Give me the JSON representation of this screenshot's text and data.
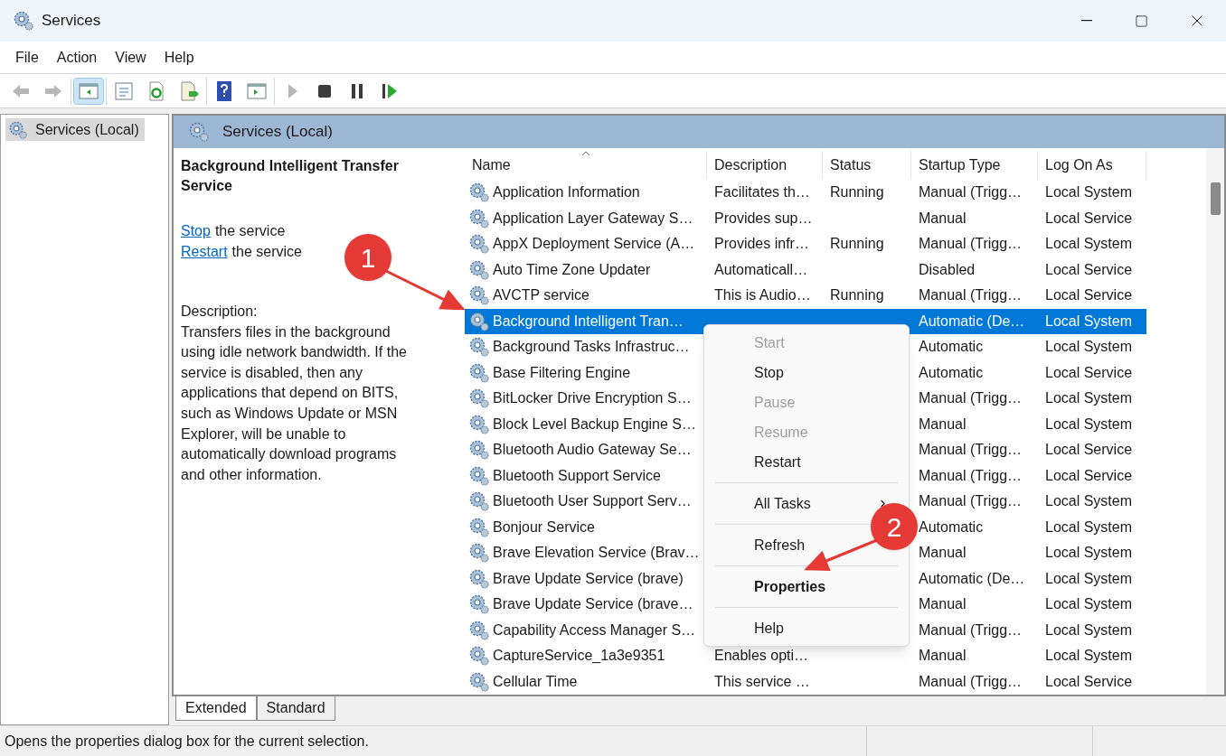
{
  "window": {
    "title": "Services"
  },
  "menu": [
    "File",
    "Action",
    "View",
    "Help"
  ],
  "toolbar": [
    {
      "kind": "back",
      "disabled": true,
      "pressed": false
    },
    {
      "kind": "forward",
      "disabled": true,
      "pressed": false
    },
    {
      "kind": "console-tree",
      "disabled": false,
      "pressed": true
    },
    {
      "kind": "properties",
      "disabled": false,
      "pressed": false
    },
    {
      "kind": "refresh",
      "disabled": false,
      "pressed": false
    },
    {
      "kind": "export",
      "disabled": false,
      "pressed": false
    },
    {
      "kind": "help",
      "disabled": false,
      "pressed": false
    },
    {
      "kind": "action-pane",
      "disabled": false,
      "pressed": false
    },
    {
      "kind": "play",
      "disabled": true,
      "pressed": false
    },
    {
      "kind": "stop",
      "disabled": false,
      "pressed": false
    },
    {
      "kind": "pause",
      "disabled": false,
      "pressed": false
    },
    {
      "kind": "resume",
      "disabled": false,
      "pressed": false
    }
  ],
  "tree": [
    {
      "label": "Services (Local)",
      "selected": true
    }
  ],
  "panel_header": "Services (Local)",
  "details": {
    "title": "Background Intelligent Transfer Service",
    "actions": [
      {
        "link": "Stop",
        "text": "the service"
      },
      {
        "link": "Restart",
        "text": "the service"
      }
    ],
    "description_label": "Description:",
    "description": "Transfers files in the background using idle network bandwidth. If the service is disabled, then any applications that depend on BITS, such as Windows Update or MSN Explorer, will be unable to automatically download programs and other information."
  },
  "table": {
    "columns": [
      {
        "label": "Name",
        "sorted": true
      },
      {
        "label": "Description",
        "sorted": false
      },
      {
        "label": "Status",
        "sorted": false
      },
      {
        "label": "Startup Type",
        "sorted": false
      },
      {
        "label": "Log On As",
        "sorted": false
      }
    ],
    "rows": [
      {
        "name": "Application Information",
        "description": "Facilitates th…",
        "status": "Running",
        "startup_type": "Manual (Trigg…",
        "log_on_as": "Local System",
        "selected": false
      },
      {
        "name": "Application Layer Gateway S…",
        "description": "Provides sup…",
        "startup_type": "Manual",
        "log_on_as": "Local Service",
        "selected": false
      },
      {
        "name": "AppX Deployment Service (A…",
        "description": "Provides infr…",
        "status": "Running",
        "startup_type": "Manual (Trigg…",
        "log_on_as": "Local System",
        "selected": false
      },
      {
        "name": "Auto Time Zone Updater",
        "description": "Automaticall…",
        "startup_type": "Disabled",
        "log_on_as": "Local Service",
        "selected": false
      },
      {
        "name": "AVCTP service",
        "description": "This is Audio…",
        "status": "Running",
        "startup_type": "Manual (Trigg…",
        "log_on_as": "Local Service",
        "selected": false
      },
      {
        "name": "Background Intelligent Tran…",
        "startup_type": "Automatic (De…",
        "log_on_as": "Local System",
        "selected": true
      },
      {
        "name": "Background Tasks Infrastruc…",
        "startup_type": "Automatic",
        "log_on_as": "Local System",
        "selected": false
      },
      {
        "name": "Base Filtering Engine",
        "startup_type": "Automatic",
        "log_on_as": "Local Service",
        "selected": false
      },
      {
        "name": "BitLocker Drive Encryption S…",
        "startup_type": "Manual (Trigg…",
        "log_on_as": "Local System",
        "selected": false
      },
      {
        "name": "Block Level Backup Engine S…",
        "startup_type": "Manual",
        "log_on_as": "Local System",
        "selected": false
      },
      {
        "name": "Bluetooth Audio Gateway Se…",
        "startup_type": "Manual (Trigg…",
        "log_on_as": "Local Service",
        "selected": false
      },
      {
        "name": "Bluetooth Support Service",
        "startup_type": "Manual (Trigg…",
        "log_on_as": "Local Service",
        "selected": false
      },
      {
        "name": "Bluetooth User Support Serv…",
        "startup_type": "Manual (Trigg…",
        "log_on_as": "Local System",
        "selected": false
      },
      {
        "name": "Bonjour Service",
        "startup_type": "Automatic",
        "log_on_as": "Local System",
        "selected": false
      },
      {
        "name": "Brave Elevation Service (Brav…",
        "startup_type": "Manual",
        "log_on_as": "Local System",
        "selected": false
      },
      {
        "name": "Brave Update Service (brave)",
        "startup_type": "Automatic (De…",
        "log_on_as": "Local System",
        "selected": false
      },
      {
        "name": "Brave Update Service (brave…",
        "startup_type": "Manual",
        "log_on_as": "Local System",
        "selected": false
      },
      {
        "name": "Capability Access Manager S…",
        "startup_type": "Manual (Trigg…",
        "log_on_as": "Local System",
        "selected": false
      },
      {
        "name": "CaptureService_1a3e9351",
        "description": "Enables opti…",
        "startup_type": "Manual",
        "log_on_as": "Local System",
        "selected": false
      },
      {
        "name": "Cellular Time",
        "description": "This service …",
        "startup_type": "Manual (Trigg…",
        "log_on_as": "Local Service",
        "selected": false
      }
    ]
  },
  "context_menu": [
    {
      "kind": "item",
      "label": "Start",
      "disabled": true,
      "bold": false,
      "submenu": false
    },
    {
      "kind": "item",
      "label": "Stop",
      "disabled": false,
      "bold": false,
      "submenu": false
    },
    {
      "kind": "item",
      "label": "Pause",
      "disabled": true,
      "bold": false,
      "submenu": false
    },
    {
      "kind": "item",
      "label": "Resume",
      "disabled": true,
      "bold": false,
      "submenu": false
    },
    {
      "kind": "item",
      "label": "Restart",
      "disabled": false,
      "bold": false,
      "submenu": false
    },
    {
      "kind": "separator"
    },
    {
      "kind": "item",
      "label": "All Tasks",
      "disabled": false,
      "bold": false,
      "submenu": true
    },
    {
      "kind": "separator"
    },
    {
      "kind": "item",
      "label": "Refresh",
      "disabled": false,
      "bold": false,
      "submenu": false
    },
    {
      "kind": "separator"
    },
    {
      "kind": "item",
      "label": "Properties",
      "disabled": false,
      "bold": true,
      "submenu": false
    },
    {
      "kind": "separator"
    },
    {
      "kind": "item",
      "label": "Help",
      "disabled": false,
      "bold": false,
      "submenu": false
    }
  ],
  "tabs": [
    {
      "label": "Extended",
      "selected": true
    },
    {
      "label": "Standard",
      "selected": false
    }
  ],
  "status_bar": "Opens the properties dialog box for the current selection.",
  "annotations": [
    {
      "label": "1"
    },
    {
      "label": "2"
    }
  ]
}
